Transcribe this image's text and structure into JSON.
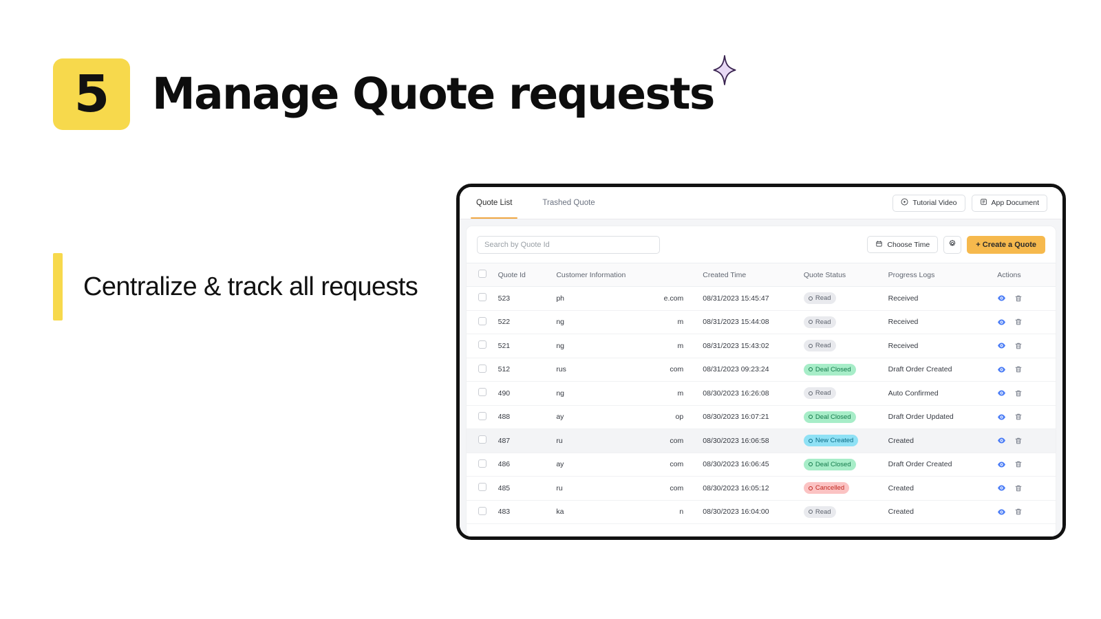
{
  "slide": {
    "step_number": "5",
    "title": "Manage Quote requests",
    "sparkle_icon": "sparkle-icon",
    "caption": "Centralize & track all requests",
    "accent_yellow": "#F7D94C",
    "accent_orange": "#F6B94D"
  },
  "app": {
    "tabs": [
      {
        "label": "Quote List",
        "active": true
      },
      {
        "label": "Trashed Quote",
        "active": false
      }
    ],
    "header_actions": [
      {
        "label": "Tutorial Video",
        "icon": "play-circle-icon"
      },
      {
        "label": "App Document",
        "icon": "document-icon"
      }
    ],
    "toolbar": {
      "search_placeholder": "Search by Quote Id",
      "search_value": "",
      "choose_time_label": "Choose Time",
      "choose_time_icon": "calendar-icon",
      "settings_icon": "gear-icon",
      "create_label": "+ Create a Quote"
    },
    "table": {
      "columns": [
        "",
        "Quote Id",
        "Customer Information",
        "Created Time",
        "Quote Status",
        "Progress Logs",
        "Actions"
      ],
      "rows": [
        {
          "quote_id": "523",
          "customer_prefix": "ph",
          "customer_suffix": "e.com",
          "created_time": "08/31/2023 15:45:47",
          "status": "Read",
          "status_kind": "read",
          "progress": "Received",
          "highlighted": false
        },
        {
          "quote_id": "522",
          "customer_prefix": "ng",
          "customer_suffix": "m",
          "created_time": "08/31/2023 15:44:08",
          "status": "Read",
          "status_kind": "read",
          "progress": "Received",
          "highlighted": false
        },
        {
          "quote_id": "521",
          "customer_prefix": "ng",
          "customer_suffix": "m",
          "created_time": "08/31/2023 15:43:02",
          "status": "Read",
          "status_kind": "read",
          "progress": "Received",
          "highlighted": false
        },
        {
          "quote_id": "512",
          "customer_prefix": "rus",
          "customer_suffix": "com",
          "created_time": "08/31/2023 09:23:24",
          "status": "Deal Closed",
          "status_kind": "deal",
          "progress": "Draft Order Created",
          "highlighted": false
        },
        {
          "quote_id": "490",
          "customer_prefix": "ng",
          "customer_suffix": "m",
          "created_time": "08/30/2023 16:26:08",
          "status": "Read",
          "status_kind": "read",
          "progress": "Auto Confirmed",
          "highlighted": false
        },
        {
          "quote_id": "488",
          "customer_prefix": "ay",
          "customer_suffix": "op",
          "created_time": "08/30/2023 16:07:21",
          "status": "Deal Closed",
          "status_kind": "deal",
          "progress": "Draft Order Updated",
          "highlighted": false
        },
        {
          "quote_id": "487",
          "customer_prefix": "ru",
          "customer_suffix": "com",
          "created_time": "08/30/2023 16:06:58",
          "status": "New Created",
          "status_kind": "newcreated",
          "progress": "Created",
          "highlighted": true
        },
        {
          "quote_id": "486",
          "customer_prefix": "ay",
          "customer_suffix": "com",
          "created_time": "08/30/2023 16:06:45",
          "status": "Deal Closed",
          "status_kind": "deal",
          "progress": "Draft Order Created",
          "highlighted": false
        },
        {
          "quote_id": "485",
          "customer_prefix": "ru",
          "customer_suffix": "com",
          "created_time": "08/30/2023 16:05:12",
          "status": "Cancelled",
          "status_kind": "cancelled",
          "progress": "Created",
          "highlighted": false
        },
        {
          "quote_id": "483",
          "customer_prefix": "ka",
          "customer_suffix": "n",
          "created_time": "08/30/2023 16:04:00",
          "status": "Read",
          "status_kind": "read",
          "progress": "Created",
          "highlighted": false
        }
      ],
      "row_actions": [
        {
          "icon": "eye-icon",
          "name": "view-quote-button"
        },
        {
          "icon": "trash-icon",
          "name": "delete-quote-button"
        }
      ]
    }
  }
}
